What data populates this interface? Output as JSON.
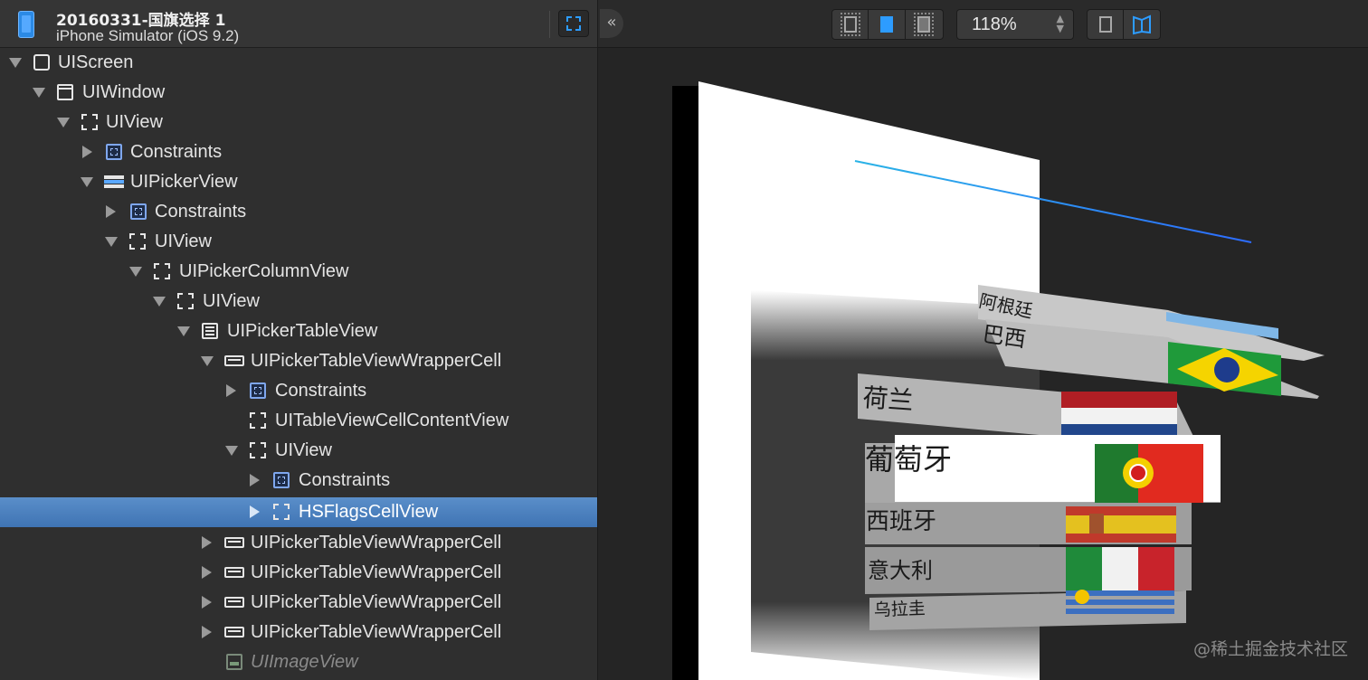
{
  "header": {
    "title": "20160331-国旗选择 1",
    "subtitle": "iPhone Simulator (iOS 9.2)",
    "device_icon": "iphone-icon",
    "focus_icon": "focus-frame-icon"
  },
  "tree": [
    {
      "label": "UIScreen",
      "icon": "screen-icon",
      "expanded": true
    },
    {
      "label": "UIWindow",
      "icon": "window-icon",
      "expanded": true
    },
    {
      "label": "UIView",
      "icon": "view-icon",
      "expanded": true
    },
    {
      "label": "Constraints",
      "icon": "constraints-icon",
      "expanded": false
    },
    {
      "label": "UIPickerView",
      "icon": "picker-view-icon",
      "expanded": true
    },
    {
      "label": "Constraints",
      "icon": "constraints-icon",
      "expanded": false
    },
    {
      "label": "UIView",
      "icon": "view-icon",
      "expanded": true
    },
    {
      "label": "UIPickerColumnView",
      "icon": "view-icon",
      "expanded": true
    },
    {
      "label": "UIView",
      "icon": "view-icon",
      "expanded": true
    },
    {
      "label": "UIPickerTableView",
      "icon": "table-view-icon",
      "expanded": true
    },
    {
      "label": "UIPickerTableViewWrapperCell",
      "icon": "table-cell-icon",
      "expanded": true
    },
    {
      "label": "Constraints",
      "icon": "constraints-icon",
      "expanded": false
    },
    {
      "label": "UITableViewCellContentView",
      "icon": "view-icon"
    },
    {
      "label": "UIView",
      "icon": "view-icon",
      "expanded": true
    },
    {
      "label": "Constraints",
      "icon": "constraints-icon",
      "expanded": false
    },
    {
      "label": "HSFlagsCellView",
      "icon": "view-icon",
      "expanded": false,
      "selected": true
    },
    {
      "label": "UIPickerTableViewWrapperCell",
      "icon": "table-cell-icon",
      "expanded": false
    },
    {
      "label": "UIPickerTableViewWrapperCell",
      "icon": "table-cell-icon",
      "expanded": false
    },
    {
      "label": "UIPickerTableViewWrapperCell",
      "icon": "table-cell-icon",
      "expanded": false
    },
    {
      "label": "UIPickerTableViewWrapperCell",
      "icon": "table-cell-icon",
      "expanded": false
    },
    {
      "label": "UIImageView",
      "icon": "image-view-icon",
      "dimmed": true
    }
  ],
  "toolbar": {
    "collapse_label": "«",
    "zoom_value": "118%",
    "zoom_stepper_icon": "stepper-arrows-icon"
  },
  "canvas": {
    "countries": [
      "阿根廷",
      "巴西",
      "荷兰",
      "葡萄牙",
      "西班牙",
      "意大利",
      "乌拉圭"
    ],
    "watermark": "@稀土掘金技术社区",
    "colors": {
      "selection": "#4a82c3",
      "accent": "#2d9cff",
      "background": "#252525"
    }
  }
}
